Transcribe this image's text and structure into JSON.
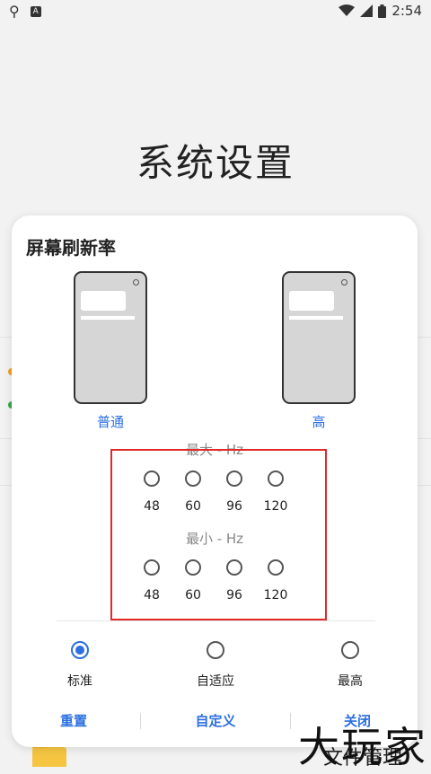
{
  "status": {
    "time": "2:54",
    "left_icons": [
      "bug-icon",
      "a-icon"
    ],
    "right_icons": [
      "wifi-icon",
      "signal-icon",
      "battery-icon"
    ]
  },
  "page_title": "系统设置",
  "dialog": {
    "title": "屏幕刷新率",
    "phones": [
      {
        "label": "普通"
      },
      {
        "label": "高"
      }
    ],
    "max_label": "最大 - Hz",
    "min_label": "最小 - Hz",
    "max_values": [
      "48",
      "60",
      "96",
      "120"
    ],
    "min_values": [
      "48",
      "60",
      "96",
      "120"
    ],
    "modes": [
      {
        "label": "标准",
        "selected": true
      },
      {
        "label": "自适应",
        "selected": false
      },
      {
        "label": "最高",
        "selected": false
      }
    ],
    "actions": {
      "reset": "重置",
      "custom": "自定义",
      "close": "关闭"
    },
    "accent_color": "#2b6fe0",
    "highlight_color": "#e02a2a"
  },
  "background": {
    "bottom_item_label": "文件管理"
  },
  "watermark": "大玩家"
}
